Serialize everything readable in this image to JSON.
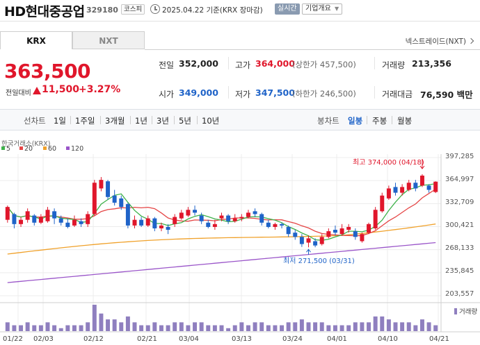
{
  "header": {
    "company": "HD현대중공업",
    "code": "329180",
    "market": "코스피",
    "as_of": "2025.04.22 기준(KRX 장마감)",
    "realtime": "실시간",
    "overview": "기업개요"
  },
  "tabs": [
    {
      "label": "KRX"
    },
    {
      "label": "NXT"
    }
  ],
  "nextrade_link": "넥스트레이드(NXT)",
  "quote": {
    "price": "363,500",
    "change_label": "전일대비",
    "change": "11,500",
    "change_pct": "+3.27%"
  },
  "stats": {
    "prev_label": "전일",
    "prev": "352,000",
    "high_label": "고가",
    "high": "364,000",
    "upper_limit": "(상한가 457,500)",
    "volume_label": "거래량",
    "volume": "213,356",
    "open_label": "시가",
    "open": "349,000",
    "low_label": "저가",
    "low": "347,500",
    "lower_limit": "(하한가 246,500)",
    "amount_label": "거래대금",
    "amount": "76,590 백만"
  },
  "periods": {
    "line_label": "선차트",
    "line_items": [
      "1일",
      "1주일",
      "3개월",
      "1년",
      "3년",
      "5년",
      "10년"
    ],
    "candle_label": "봉차트",
    "candle_items": [
      "일봉",
      "주봉",
      "월봉"
    ],
    "candle_selected": "일봉"
  },
  "colors": {
    "up": "#e0162b",
    "down": "#1f63c8",
    "ma5": "#3eb24a",
    "ma20": "#e54545",
    "ma60": "#f0a12a",
    "ma120": "#9a55c9",
    "volume": "#8f7fbf"
  },
  "chart_data": {
    "type": "candlestick",
    "source": "한국거래소(KRX)",
    "moving_averages": [
      {
        "name": "5",
        "color": "#3eb24a"
      },
      {
        "name": "20",
        "color": "#e54545"
      },
      {
        "name": "60",
        "color": "#f0a12a"
      },
      {
        "name": "120",
        "color": "#9a55c9"
      }
    ],
    "y_ticks": [
      "397,285",
      "364,997",
      "332,709",
      "300,421",
      "268,133",
      "235,845",
      "203,557"
    ],
    "ylim": [
      203557,
      397285
    ],
    "x_ticks": [
      "01/22",
      "02/03",
      "02/12",
      "02/21",
      "03/04",
      "03/13",
      "03/24",
      "04/01",
      "04/10",
      "04/21"
    ],
    "high_annotation": "최고 374,000 (04/18)",
    "low_annotation": "최저 271,500 (03/31)",
    "volume_label": "거래량",
    "candles": [
      {
        "o": 310000,
        "c": 328000,
        "h": 330000,
        "l": 306000
      },
      {
        "o": 318000,
        "c": 304000,
        "h": 320000,
        "l": 298000
      },
      {
        "o": 304000,
        "c": 310000,
        "h": 314000,
        "l": 300000
      },
      {
        "o": 310000,
        "c": 322000,
        "h": 326000,
        "l": 306000
      },
      {
        "o": 316000,
        "c": 306000,
        "h": 318000,
        "l": 302000
      },
      {
        "o": 306000,
        "c": 314000,
        "h": 318000,
        "l": 304000
      },
      {
        "o": 308000,
        "c": 324000,
        "h": 328000,
        "l": 306000
      },
      {
        "o": 322000,
        "c": 312000,
        "h": 326000,
        "l": 304000
      },
      {
        "o": 312000,
        "c": 306000,
        "h": 316000,
        "l": 302000
      },
      {
        "o": 306000,
        "c": 300000,
        "h": 312000,
        "l": 298000
      },
      {
        "o": 302000,
        "c": 310000,
        "h": 316000,
        "l": 300000
      },
      {
        "o": 308000,
        "c": 304000,
        "h": 312000,
        "l": 300000
      },
      {
        "o": 304000,
        "c": 318000,
        "h": 322000,
        "l": 300000
      },
      {
        "o": 318000,
        "c": 362000,
        "h": 366000,
        "l": 316000
      },
      {
        "o": 354000,
        "c": 366000,
        "h": 370000,
        "l": 350000
      },
      {
        "o": 364000,
        "c": 342000,
        "h": 366000,
        "l": 338000
      },
      {
        "o": 344000,
        "c": 334000,
        "h": 352000,
        "l": 330000
      },
      {
        "o": 340000,
        "c": 328000,
        "h": 344000,
        "l": 324000
      },
      {
        "o": 332000,
        "c": 302000,
        "h": 334000,
        "l": 298000
      },
      {
        "o": 302000,
        "c": 310000,
        "h": 316000,
        "l": 298000
      },
      {
        "o": 310000,
        "c": 302000,
        "h": 314000,
        "l": 300000
      },
      {
        "o": 302000,
        "c": 312000,
        "h": 316000,
        "l": 300000
      },
      {
        "o": 312000,
        "c": 298000,
        "h": 314000,
        "l": 294000
      },
      {
        "o": 298000,
        "c": 302000,
        "h": 306000,
        "l": 294000
      },
      {
        "o": 300000,
        "c": 296000,
        "h": 304000,
        "l": 290000
      },
      {
        "o": 304000,
        "c": 314000,
        "h": 318000,
        "l": 300000
      },
      {
        "o": 312000,
        "c": 320000,
        "h": 324000,
        "l": 310000
      },
      {
        "o": 316000,
        "c": 324000,
        "h": 328000,
        "l": 314000
      },
      {
        "o": 324000,
        "c": 320000,
        "h": 330000,
        "l": 316000
      },
      {
        "o": 316000,
        "c": 308000,
        "h": 320000,
        "l": 304000
      },
      {
        "o": 306000,
        "c": 300000,
        "h": 310000,
        "l": 298000
      },
      {
        "o": 300000,
        "c": 304000,
        "h": 310000,
        "l": 296000
      },
      {
        "o": 312000,
        "c": 316000,
        "h": 320000,
        "l": 308000
      },
      {
        "o": 316000,
        "c": 308000,
        "h": 318000,
        "l": 304000
      },
      {
        "o": 308000,
        "c": 312000,
        "h": 318000,
        "l": 306000
      },
      {
        "o": 312000,
        "c": 314000,
        "h": 318000,
        "l": 308000
      },
      {
        "o": 314000,
        "c": 320000,
        "h": 324000,
        "l": 312000
      },
      {
        "o": 322000,
        "c": 318000,
        "h": 326000,
        "l": 314000
      },
      {
        "o": 318000,
        "c": 306000,
        "h": 320000,
        "l": 302000
      },
      {
        "o": 306000,
        "c": 300000,
        "h": 310000,
        "l": 298000
      },
      {
        "o": 300000,
        "c": 304000,
        "h": 306000,
        "l": 296000
      },
      {
        "o": 304000,
        "c": 302000,
        "h": 306000,
        "l": 298000
      },
      {
        "o": 300000,
        "c": 290000,
        "h": 302000,
        "l": 286000
      },
      {
        "o": 292000,
        "c": 286000,
        "h": 296000,
        "l": 282000
      },
      {
        "o": 286000,
        "c": 276000,
        "h": 290000,
        "l": 272000
      },
      {
        "o": 278000,
        "c": 284000,
        "h": 288000,
        "l": 271500
      },
      {
        "o": 280000,
        "c": 274000,
        "h": 284000,
        "l": 271500
      },
      {
        "o": 276000,
        "c": 286000,
        "h": 290000,
        "l": 274000
      },
      {
        "o": 286000,
        "c": 294000,
        "h": 298000,
        "l": 284000
      },
      {
        "o": 296000,
        "c": 292000,
        "h": 302000,
        "l": 288000
      },
      {
        "o": 290000,
        "c": 298000,
        "h": 304000,
        "l": 288000
      },
      {
        "o": 296000,
        "c": 300000,
        "h": 304000,
        "l": 292000
      },
      {
        "o": 294000,
        "c": 286000,
        "h": 298000,
        "l": 282000
      },
      {
        "o": 280000,
        "c": 290000,
        "h": 292000,
        "l": 278000
      },
      {
        "o": 292000,
        "c": 304000,
        "h": 306000,
        "l": 290000
      },
      {
        "o": 298000,
        "c": 324000,
        "h": 328000,
        "l": 296000
      },
      {
        "o": 322000,
        "c": 344000,
        "h": 348000,
        "l": 320000
      },
      {
        "o": 340000,
        "c": 354000,
        "h": 358000,
        "l": 338000
      },
      {
        "o": 356000,
        "c": 348000,
        "h": 362000,
        "l": 344000
      },
      {
        "o": 348000,
        "c": 356000,
        "h": 360000,
        "l": 344000
      },
      {
        "o": 352000,
        "c": 362000,
        "h": 366000,
        "l": 350000
      },
      {
        "o": 362000,
        "c": 354000,
        "h": 366000,
        "l": 350000
      },
      {
        "o": 358000,
        "c": 372000,
        "h": 374000,
        "l": 356000
      },
      {
        "o": 358000,
        "c": 352000,
        "h": 360000,
        "l": 348000
      },
      {
        "o": 349000,
        "c": 363500,
        "h": 364000,
        "l": 347500
      }
    ],
    "volumes": [
      3,
      2,
      2,
      3,
      2,
      2,
      3,
      2,
      1,
      2,
      2,
      2,
      3,
      9,
      6,
      4,
      4,
      3,
      5,
      3,
      2,
      2,
      3,
      2,
      2,
      3,
      3,
      2,
      3,
      3,
      2,
      2,
      2,
      1,
      2,
      3,
      2,
      3,
      3,
      2,
      2,
      2,
      3,
      3,
      4,
      3,
      3,
      3,
      2,
      2,
      2,
      2,
      3,
      3,
      3,
      5,
      5,
      4,
      3,
      3,
      3,
      2,
      4,
      3,
      2
    ]
  }
}
